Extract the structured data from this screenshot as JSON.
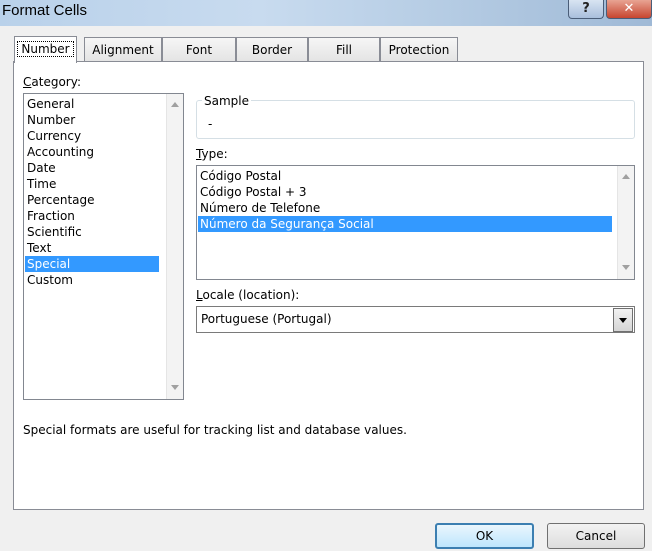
{
  "window": {
    "title": "Format Cells",
    "help_label": "?",
    "close_label": "✕"
  },
  "tabs": [
    {
      "label": "Number",
      "active": true
    },
    {
      "label": "Alignment"
    },
    {
      "label": "Font"
    },
    {
      "label": "Border"
    },
    {
      "label": "Fill"
    },
    {
      "label": "Protection"
    }
  ],
  "category": {
    "label_prefix": "C",
    "label_rest": "ategory:",
    "items": [
      "General",
      "Number",
      "Currency",
      "Accounting",
      "Date",
      "Time",
      "Percentage",
      "Fraction",
      "Scientific",
      "Text",
      "Special",
      "Custom"
    ],
    "selected": "Special"
  },
  "sample": {
    "label": "Sample",
    "value": "-"
  },
  "type": {
    "label_prefix": "T",
    "label_rest": "ype:",
    "items": [
      "Código Postal",
      "Código Postal + 3",
      "Número de Telefone",
      "Número da Segurança Social"
    ],
    "selected": "Número da Segurança Social"
  },
  "locale": {
    "label_prefix": "L",
    "label_rest": "ocale (location):",
    "value": "Portuguese (Portugal)"
  },
  "description": "Special formats are useful for tracking list and database values.",
  "buttons": {
    "ok": "OK",
    "cancel": "Cancel"
  },
  "colors": {
    "selection": "#3399ff",
    "default_button_border": "#3c7fb1"
  }
}
